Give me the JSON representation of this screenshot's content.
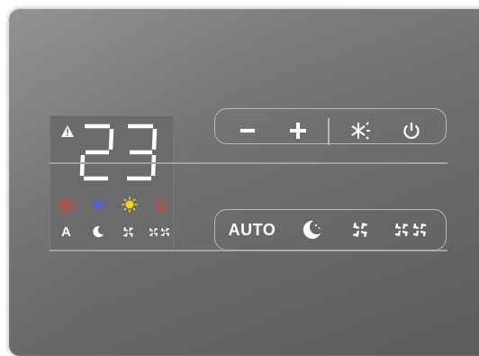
{
  "display": {
    "temperature": "23",
    "warning_icon": "warning-triangle-icon",
    "mode_icons": [
      {
        "name": "heater-icon",
        "color": "#e23b3b"
      },
      {
        "name": "snowflake-icon",
        "color": "#4a5cff"
      },
      {
        "name": "sun-icon",
        "color": "#f2d42a"
      },
      {
        "name": "power-icon",
        "color": "#e23b3b"
      }
    ],
    "fan_row": {
      "auto_label": "A",
      "icons": [
        "moon-icon",
        "fan-low-icon",
        "fan-high-icon"
      ]
    }
  },
  "top_bar": {
    "minus_label": "−",
    "plus_label": "+",
    "icons": [
      "minus-icon",
      "plus-icon",
      "mode-icon",
      "power-icon"
    ]
  },
  "bottom_bar": {
    "auto_label": "AUTO",
    "icons": [
      "moon-icon",
      "fan-low-icon",
      "fan-high-icon"
    ]
  },
  "colors": {
    "panel": "#6f6f6f",
    "display_bg": "#6b6b6b",
    "segment": "#ffffff",
    "outline": "#b8b8b8"
  }
}
